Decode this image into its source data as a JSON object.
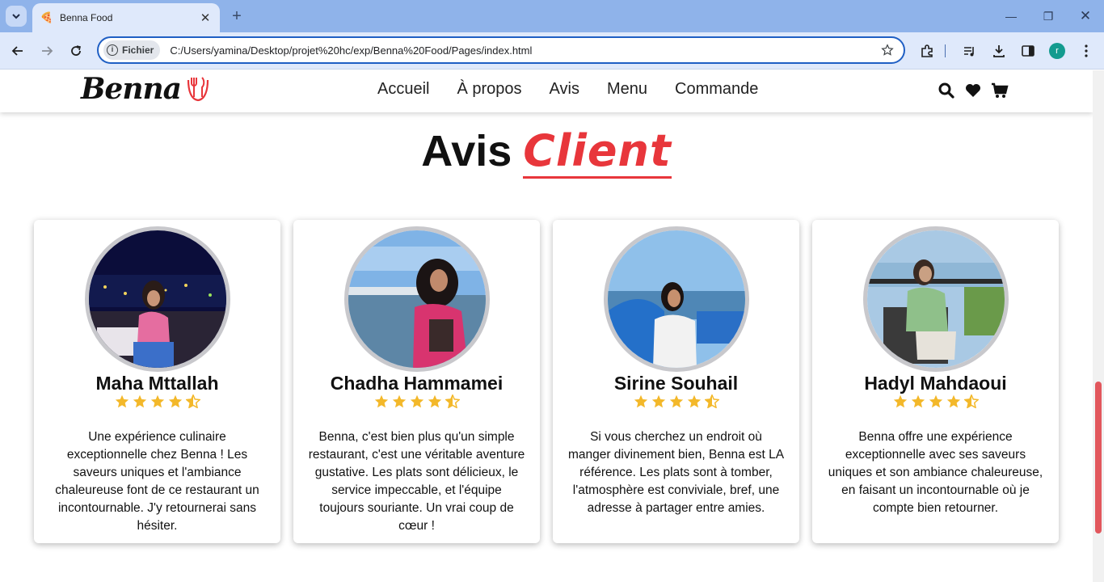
{
  "browser": {
    "tab_title": "Benna Food",
    "chip_label": "Fichier",
    "url": "C:/Users/yamina/Desktop/projet%20hc/exp/Benna%20Food/Pages/index.html",
    "profile_initial": "r"
  },
  "site": {
    "logo_text": "Benna",
    "nav": [
      "Accueil",
      "À propos",
      "Avis",
      "Menu",
      "Commande"
    ],
    "accent_color": "#e8363b"
  },
  "section": {
    "title_main": "Avis",
    "title_accent": "Client"
  },
  "reviews": [
    {
      "name": "Maha Mttallah",
      "rating": 4.5,
      "text": "Une expérience culinaire exceptionnelle chez Benna ! Les saveurs uniques et l'ambiance chaleureuse font de ce restaurant un incontournable. J'y retournerai sans hésiter."
    },
    {
      "name": "Chadha Hammamei",
      "rating": 4.5,
      "text": "Benna, c'est bien plus qu'un simple restaurant, c'est une véritable aventure gustative. Les plats sont délicieux, le service impeccable, et l'équipe toujours souriante. Un vrai coup de cœur !"
    },
    {
      "name": "Sirine Souhail",
      "rating": 4.5,
      "text": "Si vous cherchez un endroit où manger divinement bien, Benna est LA référence. Les plats sont à tomber, l'atmosphère est conviviale, bref, une adresse à partager entre amies."
    },
    {
      "name": "Hadyl Mahdaoui",
      "rating": 4.5,
      "text": "Benna offre une expérience exceptionnelle avec ses saveurs uniques et son ambiance chaleureuse, en faisant un incontournable où je compte bien retourner."
    }
  ]
}
